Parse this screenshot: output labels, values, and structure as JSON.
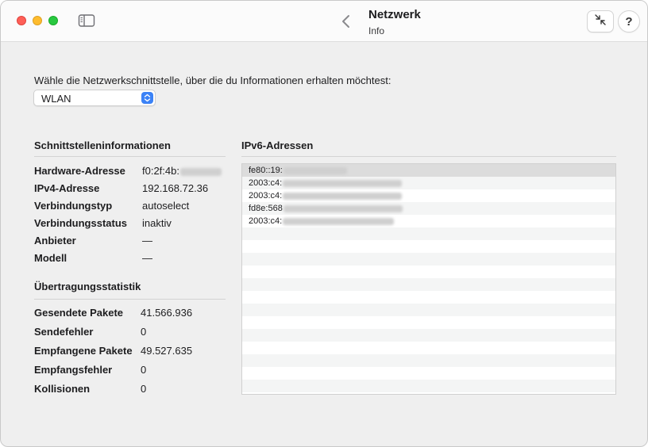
{
  "window": {
    "title": "Netzwerk",
    "subtitle": "Info",
    "help_label": "?"
  },
  "interface": {
    "prompt": "Wähle die Netzwerkschnittstelle, über die du Informationen erhalten möchtest:",
    "selected": "WLAN"
  },
  "interface_info": {
    "title": "Schnittstelleninformationen",
    "rows": [
      {
        "label": "Hardware-Adresse",
        "value": "f0:2f:4b:"
      },
      {
        "label": "IPv4-Adresse",
        "value": "192.168.72.36"
      },
      {
        "label": "Verbindungstyp",
        "value": "autoselect"
      },
      {
        "label": "Verbindungsstatus",
        "value": "inaktiv"
      },
      {
        "label": "Anbieter",
        "value": "—"
      },
      {
        "label": "Modell",
        "value": "—"
      }
    ]
  },
  "stats": {
    "title": "Übertragungsstatistik",
    "rows": [
      {
        "label": "Gesendete Pakete",
        "value": "41.566.936"
      },
      {
        "label": "Sendefehler",
        "value": "0"
      },
      {
        "label": "Empfangene Pakete",
        "value": "49.527.635"
      },
      {
        "label": "Empfangsfehler",
        "value": "0"
      },
      {
        "label": "Kollisionen",
        "value": "0"
      }
    ]
  },
  "ipv6": {
    "title": "IPv6-Adressen",
    "addresses": [
      "fe80::19:",
      "2003:c4:",
      "2003:c4:",
      "fd8e:568",
      "2003:c4:"
    ]
  },
  "colors": {
    "accent": "#3b82f6",
    "close": "#fe5f57",
    "minimize": "#febc2e",
    "maximize": "#28c840"
  }
}
